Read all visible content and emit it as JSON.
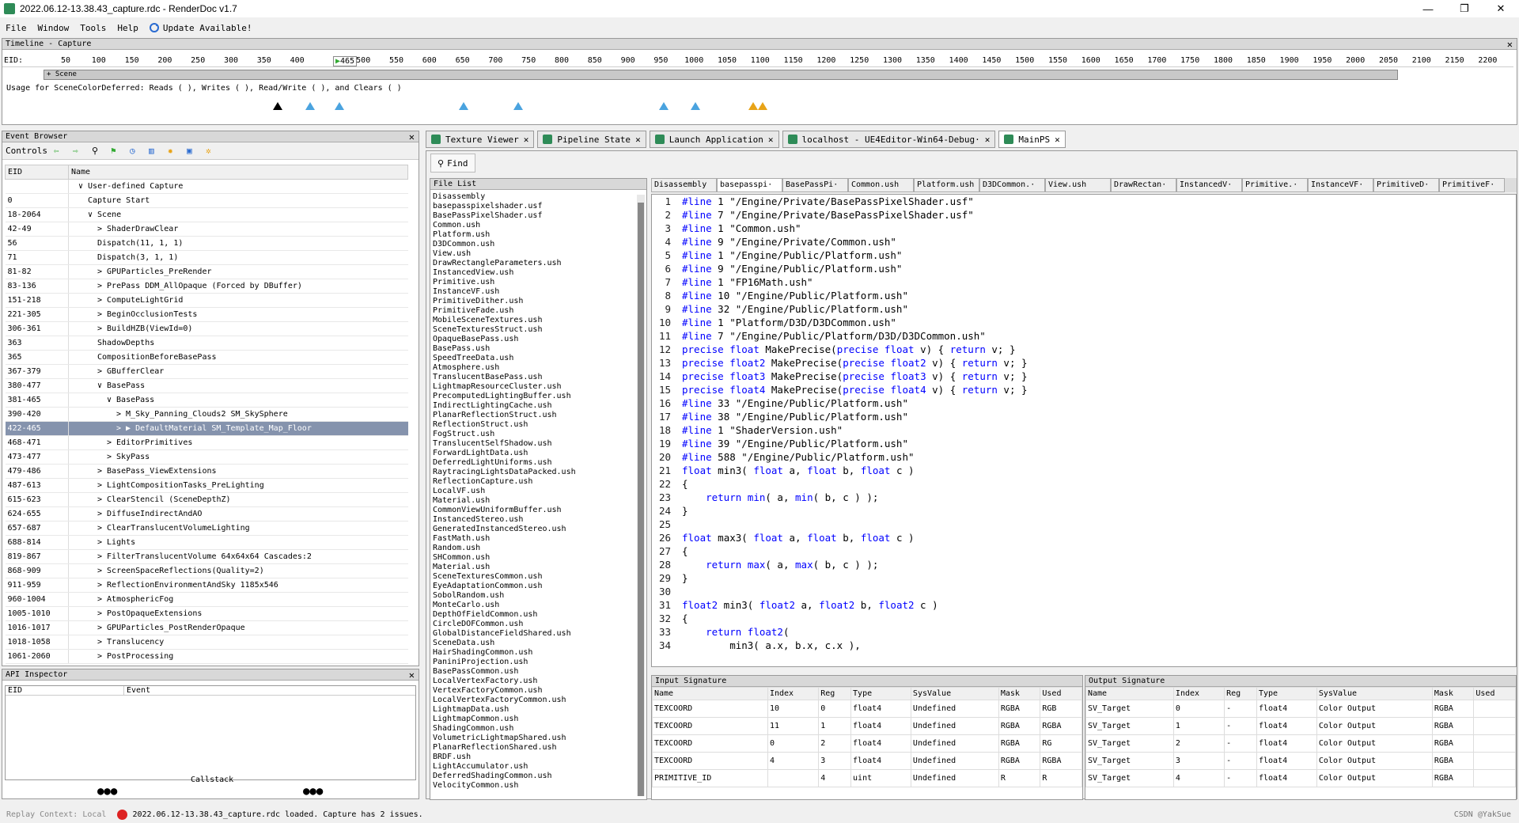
{
  "window": {
    "title": "2022.06.12-13.38.43_capture.rdc - RenderDoc v1.7"
  },
  "menu": {
    "items": [
      "File",
      "Window",
      "Tools",
      "Help"
    ],
    "update": "Update Available!"
  },
  "timeline": {
    "title": "Timeline - Capture",
    "eid_label": "EID:",
    "current_eid": "465",
    "ticks": [
      "50",
      "100",
      "150",
      "200",
      "250",
      "300",
      "350",
      "400",
      "500",
      "550",
      "600",
      "650",
      "700",
      "750",
      "800",
      "850",
      "900",
      "950",
      "1000",
      "1050",
      "1100",
      "1150",
      "1200",
      "1250",
      "1300",
      "1350",
      "1400",
      "1450",
      "1500",
      "1550",
      "1600",
      "1650",
      "1700",
      "1750",
      "1800",
      "1850",
      "1900",
      "1950",
      "2000",
      "2050",
      "2100",
      "2150",
      "2200"
    ],
    "scene_label": "+ Scene",
    "usage_text": "Usage for SceneColorDeferred: Reads ( ), Writes ( ), Read/Write ( ), and Clears ( )"
  },
  "event_browser": {
    "title": "Event Browser",
    "controls_label": "Controls",
    "col_eid": "EID",
    "col_name": "Name",
    "rows": [
      {
        "eid": "",
        "name": "∨ User-defined Capture",
        "indent": 1
      },
      {
        "eid": "0",
        "name": "Capture Start",
        "indent": 2
      },
      {
        "eid": "18-2064",
        "name": "∨ Scene",
        "indent": 2
      },
      {
        "eid": "42-49",
        "name": "> ShaderDrawClear",
        "indent": 3
      },
      {
        "eid": "56",
        "name": "Dispatch(11, 1, 1)",
        "indent": 3
      },
      {
        "eid": "71",
        "name": "Dispatch(3, 1, 1)",
        "indent": 3
      },
      {
        "eid": "81-82",
        "name": "> GPUParticles_PreRender",
        "indent": 3
      },
      {
        "eid": "83-136",
        "name": "> PrePass DDM_AllOpaque (Forced by DBuffer)",
        "indent": 3
      },
      {
        "eid": "151-218",
        "name": "> ComputeLightGrid",
        "indent": 3
      },
      {
        "eid": "221-305",
        "name": "> BeginOcclusionTests",
        "indent": 3
      },
      {
        "eid": "306-361",
        "name": "> BuildHZB(ViewId=0)",
        "indent": 3
      },
      {
        "eid": "363",
        "name": "ShadowDepths",
        "indent": 3
      },
      {
        "eid": "365",
        "name": "CompositionBeforeBasePass",
        "indent": 3
      },
      {
        "eid": "367-379",
        "name": "> GBufferClear",
        "indent": 3
      },
      {
        "eid": "380-477",
        "name": "∨ BasePass",
        "indent": 3
      },
      {
        "eid": "381-465",
        "name": "∨ BasePass",
        "indent": 4
      },
      {
        "eid": "390-420",
        "name": "> M_Sky_Panning_Clouds2 SM_SkySphere",
        "indent": 5
      },
      {
        "eid": "422-465",
        "name": "> ▶ DefaultMaterial SM_Template_Map_Floor",
        "indent": 5,
        "selected": true
      },
      {
        "eid": "468-471",
        "name": "> EditorPrimitives",
        "indent": 4
      },
      {
        "eid": "473-477",
        "name": "> SkyPass",
        "indent": 4
      },
      {
        "eid": "479-486",
        "name": "> BasePass_ViewExtensions",
        "indent": 3
      },
      {
        "eid": "487-613",
        "name": "> LightCompositionTasks_PreLighting",
        "indent": 3
      },
      {
        "eid": "615-623",
        "name": "> ClearStencil (SceneDepthZ)",
        "indent": 3
      },
      {
        "eid": "624-655",
        "name": "> DiffuseIndirectAndAO",
        "indent": 3
      },
      {
        "eid": "657-687",
        "name": "> ClearTranslucentVolumeLighting",
        "indent": 3
      },
      {
        "eid": "688-814",
        "name": "> Lights",
        "indent": 3
      },
      {
        "eid": "819-867",
        "name": "> FilterTranslucentVolume 64x64x64 Cascades:2",
        "indent": 3
      },
      {
        "eid": "868-909",
        "name": "> ScreenSpaceReflections(Quality=2)",
        "indent": 3
      },
      {
        "eid": "911-959",
        "name": "> ReflectionEnvironmentAndSky 1185x546",
        "indent": 3
      },
      {
        "eid": "960-1004",
        "name": "> AtmosphericFog",
        "indent": 3
      },
      {
        "eid": "1005-1010",
        "name": "> PostOpaqueExtensions",
        "indent": 3
      },
      {
        "eid": "1016-1017",
        "name": "> GPUParticles_PostRenderOpaque",
        "indent": 3
      },
      {
        "eid": "1018-1058",
        "name": "> Translucency",
        "indent": 3
      },
      {
        "eid": "1061-2060",
        "name": "> PostProcessing",
        "indent": 3
      }
    ]
  },
  "api_inspector": {
    "title": "API Inspector",
    "col_eid": "EID",
    "col_event": "Event",
    "callstack": "Callstack"
  },
  "tabs": [
    {
      "label": "Texture Viewer",
      "active": false
    },
    {
      "label": "Pipeline State",
      "active": false
    },
    {
      "label": "Launch Application",
      "active": false
    },
    {
      "label": "localhost - UE4Editor-Win64-Debug·",
      "active": false
    },
    {
      "label": "MainPS",
      "active": true
    }
  ],
  "shader": {
    "find_label": "Find",
    "file_list_title": "File List",
    "files": [
      "Disassembly",
      "basepasspixelshader.usf",
      "BasePassPixelShader.usf",
      "Common.ush",
      "Platform.ush",
      "D3DCommon.ush",
      "View.ush",
      "DrawRectangleParameters.ush",
      "InstancedView.ush",
      "Primitive.ush",
      "InstanceVF.ush",
      "PrimitiveDither.ush",
      "PrimitiveFade.ush",
      "MobileSceneTextures.ush",
      "SceneTexturesStruct.ush",
      "OpaqueBasePass.ush",
      "BasePass.ush",
      "SpeedTreeData.ush",
      "Atmosphere.ush",
      "TranslucentBasePass.ush",
      "LightmapResourceCluster.ush",
      "PrecomputedLightingBuffer.ush",
      "IndirectLightingCache.ush",
      "PlanarReflectionStruct.ush",
      "ReflectionStruct.ush",
      "FogStruct.ush",
      "TranslucentSelfShadow.ush",
      "ForwardLightData.ush",
      "DeferredLightUniforms.ush",
      "RaytracingLightsDataPacked.ush",
      "ReflectionCapture.ush",
      "LocalVF.ush",
      "Material.ush",
      "CommonViewUniformBuffer.ush",
      "InstancedStereo.ush",
      "GeneratedInstancedStereo.ush",
      "FastMath.ush",
      "Random.ush",
      "SHCommon.ush",
      "Material.ush",
      "SceneTexturesCommon.ush",
      "EyeAdaptationCommon.ush",
      "SobolRandom.ush",
      "MonteCarlo.ush",
      "DepthOfFieldCommon.ush",
      "CircleDOFCommon.ush",
      "GlobalDistanceFieldShared.ush",
      "SceneData.ush",
      "HairShadingCommon.ush",
      "PaniniProjection.ush",
      "BasePassCommon.ush",
      "LocalVertexFactory.ush",
      "VertexFactoryCommon.ush",
      "LocalVertexFactoryCommon.ush",
      "LightmapData.ush",
      "LightmapCommon.ush",
      "ShadingCommon.ush",
      "VolumetricLightmapShared.ush",
      "PlanarReflectionShared.ush",
      "BRDF.ush",
      "LightAccumulator.ush",
      "DeferredShadingCommon.ush",
      "VelocityCommon.ush"
    ],
    "source_tabs": [
      "Disassembly",
      "basepasspi·",
      "BasePassPi·",
      "Common.ush",
      "Platform.ush",
      "D3DCommon.·",
      "View.ush",
      "DrawRectan·",
      "InstancedV·",
      "Primitive.·",
      "InstanceVF·",
      "PrimitiveD·",
      "PrimitiveF·"
    ],
    "code": [
      [
        "#line",
        " 1 \"/Engine/Private/BasePassPixelShader.usf\""
      ],
      [
        "#line",
        " 7 \"/Engine/Private/BasePassPixelShader.usf\""
      ],
      [
        "#line",
        " 1 \"Common.ush\""
      ],
      [
        "#line",
        " 9 \"/Engine/Private/Common.ush\""
      ],
      [
        "#line",
        " 1 \"/Engine/Public/Platform.ush\""
      ],
      [
        "#line",
        " 9 \"/Engine/Public/Platform.ush\""
      ],
      [
        "#line",
        " 1 \"FP16Math.ush\""
      ],
      [
        "#line",
        " 10 \"/Engine/Public/Platform.ush\""
      ],
      [
        "#line",
        " 32 \"/Engine/Public/Platform.ush\""
      ],
      [
        "#line",
        " 1 \"Platform/D3D/D3DCommon.ush\""
      ],
      [
        "#line",
        " 7 \"/Engine/Public/Platform/D3D/D3DCommon.ush\""
      ],
      [
        "",
        "precise float MakePrecise(precise float v) { return v; }"
      ],
      [
        "",
        "precise float2 MakePrecise(precise float2 v) { return v; }"
      ],
      [
        "",
        "precise float3 MakePrecise(precise float3 v) { return v; }"
      ],
      [
        "",
        "precise float4 MakePrecise(precise float4 v) { return v; }"
      ],
      [
        "#line",
        " 33 \"/Engine/Public/Platform.ush\""
      ],
      [
        "#line",
        " 38 \"/Engine/Public/Platform.ush\""
      ],
      [
        "#line",
        " 1 \"ShaderVersion.ush\""
      ],
      [
        "#line",
        " 39 \"/Engine/Public/Platform.ush\""
      ],
      [
        "#line",
        " 588 \"/Engine/Public/Platform.ush\""
      ],
      [
        "",
        "float min3( float a, float b, float c )"
      ],
      [
        "",
        "{"
      ],
      [
        "",
        "    return min( a, min( b, c ) );"
      ],
      [
        "",
        "}"
      ],
      [
        "",
        ""
      ],
      [
        "",
        "float max3( float a, float b, float c )"
      ],
      [
        "",
        "{"
      ],
      [
        "",
        "    return max( a, max( b, c ) );"
      ],
      [
        "",
        "}"
      ],
      [
        "",
        ""
      ],
      [
        "",
        "float2 min3( float2 a, float2 b, float2 c )"
      ],
      [
        "",
        "{"
      ],
      [
        "",
        "    return float2("
      ],
      [
        "",
        "        min3( a.x, b.x, c.x ),"
      ]
    ],
    "input_signature": {
      "title": "Input Signature",
      "cols": [
        "Name",
        "Index",
        "Reg",
        "Type",
        "SysValue",
        "Mask",
        "Used"
      ],
      "rows": [
        [
          "TEXCOORD",
          "10",
          "0",
          "float4",
          "Undefined",
          "RGBA",
          "RGB"
        ],
        [
          "TEXCOORD",
          "11",
          "1",
          "float4",
          "Undefined",
          "RGBA",
          "RGBA"
        ],
        [
          "TEXCOORD",
          "0",
          "2",
          "float4",
          "Undefined",
          "RGBA",
          "RG"
        ],
        [
          "TEXCOORD",
          "4",
          "3",
          "float4",
          "Undefined",
          "RGBA",
          "RGBA"
        ],
        [
          "PRIMITIVE_ID",
          "",
          "4",
          "uint",
          "Undefined",
          "R",
          "R"
        ]
      ]
    },
    "output_signature": {
      "title": "Output Signature",
      "cols": [
        "Name",
        "Index",
        "Reg",
        "Type",
        "SysValue",
        "Mask",
        "Used"
      ],
      "rows": [
        [
          "SV_Target",
          "0",
          "-",
          "float4",
          "Color Output",
          "RGBA",
          ""
        ],
        [
          "SV_Target",
          "1",
          "-",
          "float4",
          "Color Output",
          "RGBA",
          ""
        ],
        [
          "SV_Target",
          "2",
          "-",
          "float4",
          "Color Output",
          "RGBA",
          ""
        ],
        [
          "SV_Target",
          "3",
          "-",
          "float4",
          "Color Output",
          "RGBA",
          ""
        ],
        [
          "SV_Target",
          "4",
          "-",
          "float4",
          "Color Output",
          "RGBA",
          ""
        ]
      ]
    }
  },
  "status": {
    "replay": "Replay Context: Local",
    "message": "2022.06.12-13.38.43_capture.rdc loaded. Capture has 2 issues.",
    "watermark": "CSDN @YakSue"
  },
  "colors": {
    "selected_row": "#8593ad",
    "keyword": "#0000ff",
    "accent": "#2e8b57"
  }
}
